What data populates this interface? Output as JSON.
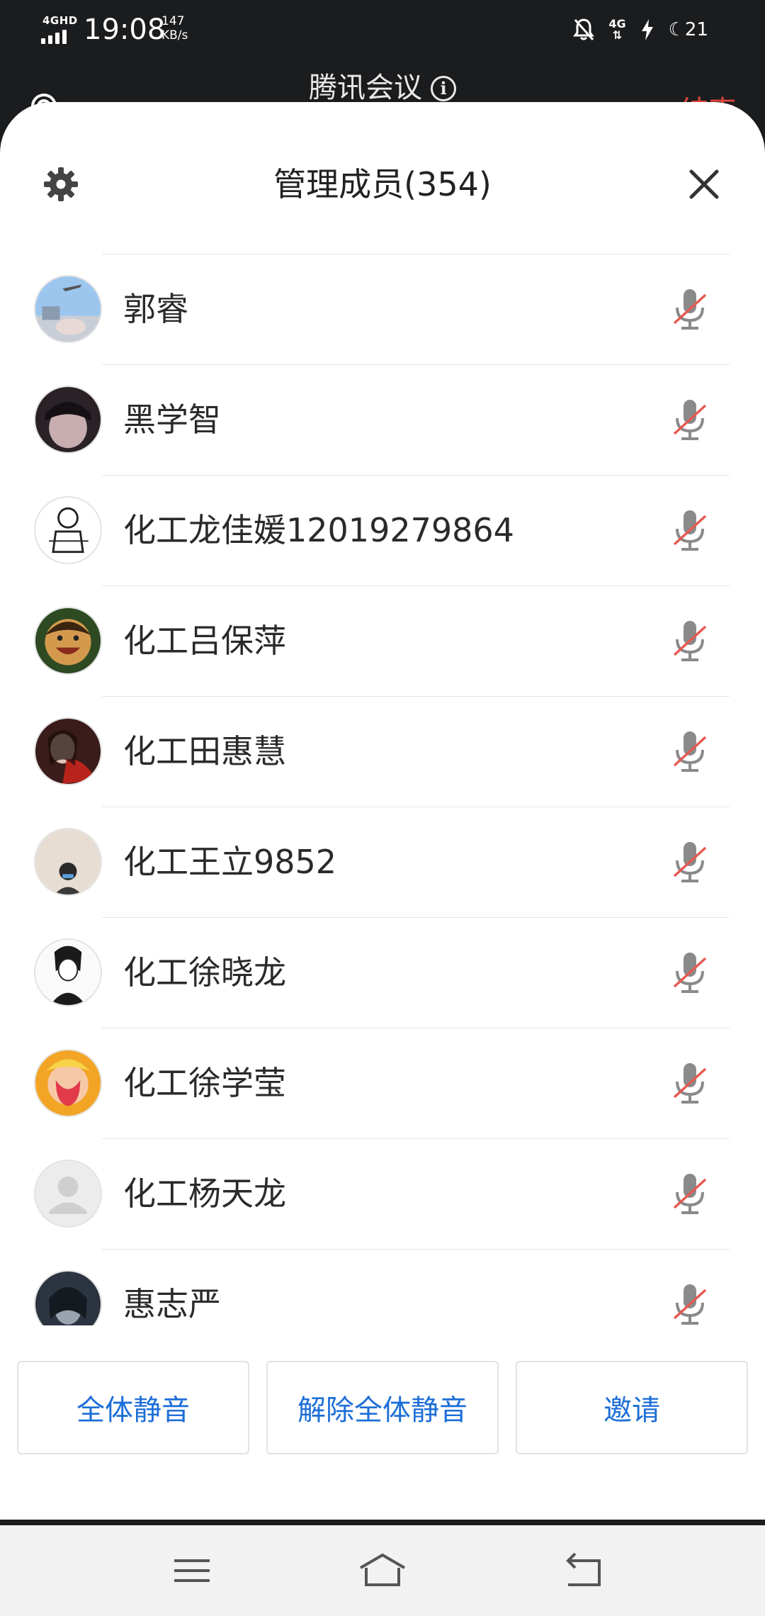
{
  "status_bar": {
    "network_label": "4GHD",
    "time": "19:08",
    "speed_value": "147",
    "speed_unit": "KB/s",
    "network_right": "4G",
    "battery": "21"
  },
  "meeting_header": {
    "title": "腾讯会议",
    "info_glyph": "i",
    "end_label": "结束"
  },
  "sheet": {
    "title": "管理成员(354)",
    "settings_icon": "gear-icon",
    "close_icon": "close-icon"
  },
  "members": [
    {
      "name": "郭睿",
      "mic": "muted"
    },
    {
      "name": "黑学智",
      "mic": "muted"
    },
    {
      "name": "化工龙佳媛12019279864",
      "mic": "muted"
    },
    {
      "name": "化工吕保萍",
      "mic": "muted"
    },
    {
      "name": "化工田惠慧",
      "mic": "muted"
    },
    {
      "name": "化工王立9852",
      "mic": "muted"
    },
    {
      "name": "化工徐晓龙",
      "mic": "muted"
    },
    {
      "name": "化工徐学莹",
      "mic": "muted"
    },
    {
      "name": "化工杨天龙",
      "mic": "muted"
    },
    {
      "name": "惠志严",
      "mic": "muted"
    }
  ],
  "actions": {
    "mute_all": "全体静音",
    "unmute_all": "解除全体静音",
    "invite": "邀请"
  },
  "colors": {
    "accent": "#1d6ed8",
    "end_red": "#e0453d",
    "muted_slash": "#e45a52"
  }
}
